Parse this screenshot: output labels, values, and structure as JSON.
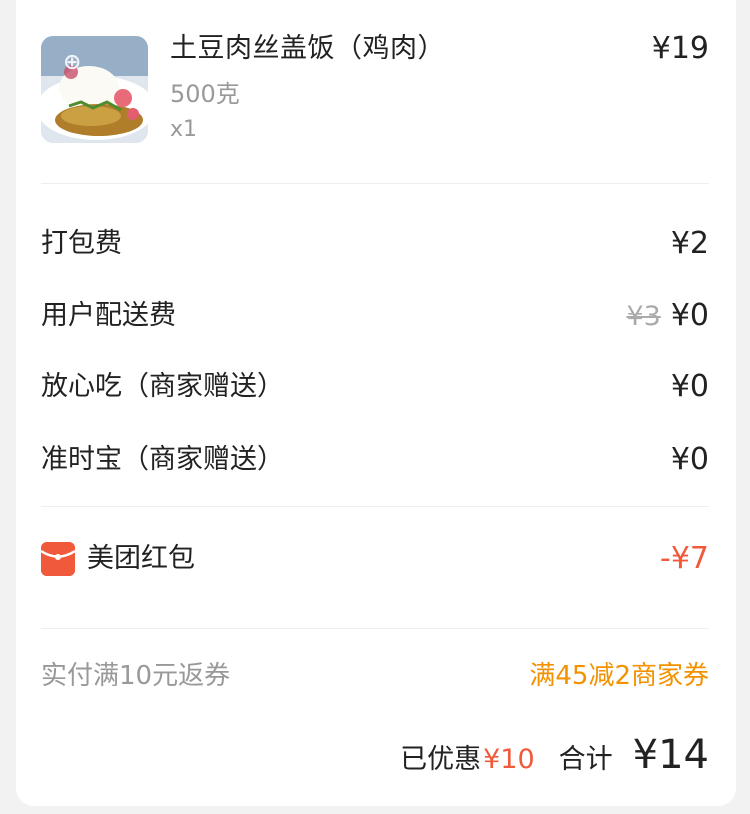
{
  "order_item": {
    "name": "土豆肉丝盖饭（鸡肉）",
    "spec": "500克",
    "qty": "x1",
    "price": "¥19"
  },
  "fees": [
    {
      "label": "打包费",
      "value": "¥2",
      "original": ""
    },
    {
      "label": "用户配送费",
      "value": "¥0",
      "original": "¥3"
    },
    {
      "label": "放心吃（商家赠送）",
      "value": "¥0",
      "original": ""
    },
    {
      "label": "准时宝（商家赠送）",
      "value": "¥0",
      "original": ""
    }
  ],
  "red_packet": {
    "icon": "red-packet-icon",
    "label": "美团红包",
    "value": "-¥7"
  },
  "coupon": {
    "left": "实付满10元返券",
    "right": "满45减2商家券"
  },
  "summary": {
    "saved_label": "已优惠",
    "saved_value": "¥10",
    "total_label": "合计",
    "total_value": "¥14"
  },
  "colors": {
    "accent_red": "#f05a3a",
    "coupon_orange": "#f39200"
  }
}
